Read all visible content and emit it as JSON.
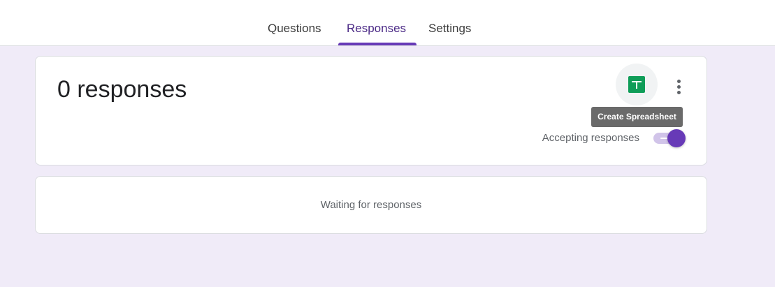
{
  "tabs": [
    {
      "label": "Questions",
      "active": false
    },
    {
      "label": "Responses",
      "active": true
    },
    {
      "label": "Settings",
      "active": false
    }
  ],
  "summary": {
    "response_count": "0 responses",
    "create_sheet_icon": "google-sheets-icon",
    "more_icon": "more-vert-icon",
    "tooltip": "Create Spreadsheet",
    "accepting_label": "Accepting responses",
    "accepting_enabled": true
  },
  "empty_state": {
    "message": "Waiting for responses"
  },
  "colors": {
    "accent": "#673ab7",
    "background": "#f0ebf8",
    "sheets_green": "#0f9d58"
  }
}
